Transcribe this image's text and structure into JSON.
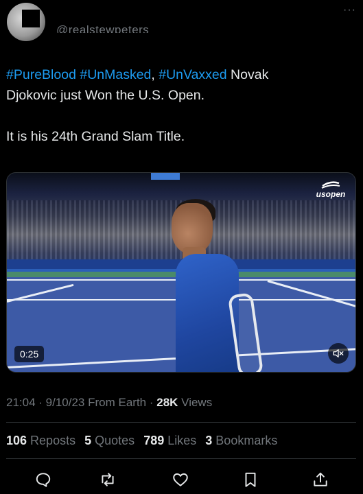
{
  "author": {
    "handle": "@realstewpeters"
  },
  "more_label": "···",
  "tweet": {
    "hashtag1": "#PureBlood",
    "sep1": " ",
    "hashtag2": "#UnMasked",
    "sep2": ", ",
    "hashtag3": "#UnVaxxed",
    "text_after": " Novak",
    "line2": "Djokovic just  Won the U.S. Open.",
    "para2": "It is his 24th Grand Slam Title."
  },
  "media": {
    "brand": "usopen",
    "duration": "0:25",
    "mute_icon": "speaker-muted-icon"
  },
  "meta": {
    "time": "21:04",
    "dot1": " · ",
    "date": "9/10/23",
    "source": " From Earth",
    "dot2": " · ",
    "views_count": "28K",
    "views_label": " Views"
  },
  "stats": {
    "reposts_count": "106",
    "reposts_label": " Reposts",
    "quotes_count": "5",
    "quotes_label": " Quotes",
    "likes_count": "789",
    "likes_label": " Likes",
    "bookmarks_count": "3",
    "bookmarks_label": " Bookmarks"
  },
  "actions": [
    "reply-icon",
    "repost-icon",
    "like-icon",
    "bookmark-icon",
    "share-icon"
  ],
  "colors": {
    "background": "#000000",
    "text": "#e7e9ea",
    "secondary": "#71767b",
    "link": "#1d9bf0",
    "divider": "#2f3336"
  }
}
